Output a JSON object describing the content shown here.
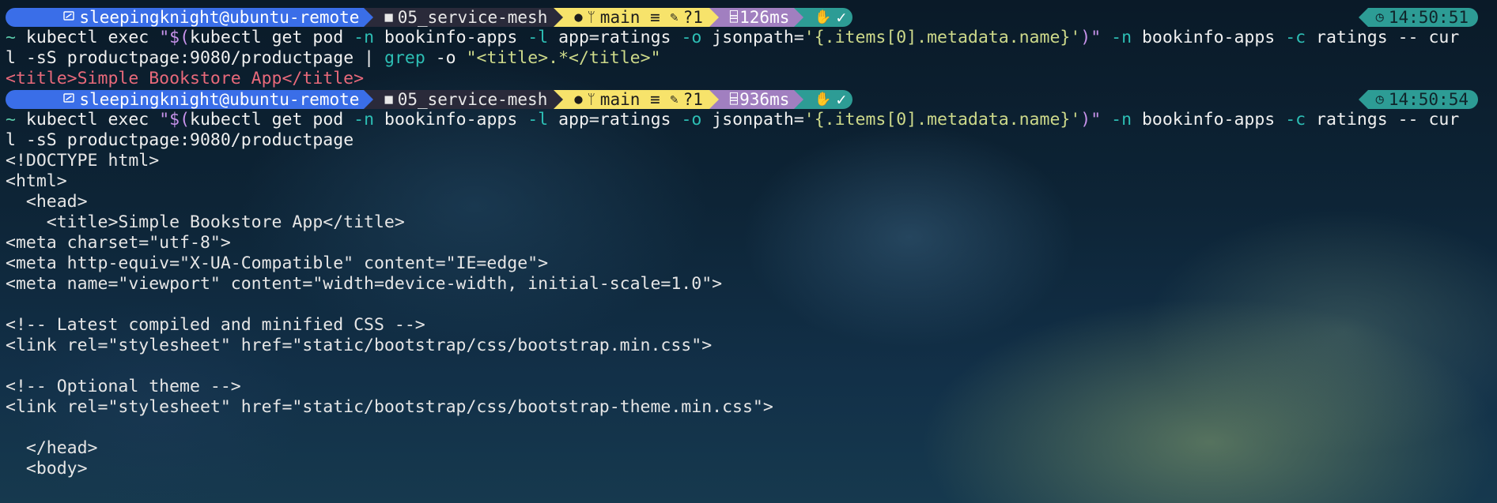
{
  "prompts": [
    {
      "user": "sleepingknight@ubuntu-remote",
      "dir": "05_service-mesh",
      "branch": "main",
      "git_flags": "≡",
      "git_changes": "?1",
      "exec_time": "126ms",
      "status": "✓",
      "clock": "14:50:51"
    },
    {
      "user": "sleepingknight@ubuntu-remote",
      "dir": "05_service-mesh",
      "branch": "main",
      "git_flags": "≡",
      "git_changes": "?1",
      "exec_time": "936ms",
      "status": "✓",
      "clock": "14:50:54"
    }
  ],
  "cmd1": {
    "tilde": "~",
    "kubectl": "kubectl",
    "exec": "exec",
    "sub_open": "\"$(",
    "inner_kubectl": "kubectl",
    "get_pod": "get pod",
    "n_flag": "-n",
    "ns": "bookinfo-apps",
    "l_flag": "-l",
    "label": "app=ratings",
    "o_flag": "-o",
    "jsonpath_key": "jsonpath=",
    "jsonpath_val": "'{.items[0].metadata.name}'",
    "sub_close": ")\"",
    "n_flag2": "-n",
    "ns2": "bookinfo-apps",
    "c_flag": "-c",
    "container": "ratings",
    "dashdash": "--",
    "cur": "cur",
    "line2_curl": "l",
    "sS": "-sS",
    "url": "productpage:9080/productpage",
    "pipe": "|",
    "grep": "grep",
    "grep_o": "-o",
    "grep_pattern": "\"<title>.*</title>\"",
    "output": "<title>Simple Bookstore App</title>"
  },
  "cmd2": {
    "tilde": "~",
    "kubectl": "kubectl",
    "exec": "exec",
    "sub_open": "\"$(",
    "inner_kubectl": "kubectl",
    "get_pod": "get pod",
    "n_flag": "-n",
    "ns": "bookinfo-apps",
    "l_flag": "-l",
    "label": "app=ratings",
    "o_flag": "-o",
    "jsonpath_key": "jsonpath=",
    "jsonpath_val": "'{.items[0].metadata.name}'",
    "sub_close": ")\"",
    "n_flag2": "-n",
    "ns2": "bookinfo-apps",
    "c_flag": "-c",
    "container": "ratings",
    "dashdash": "--",
    "cur": "cur",
    "line2_curl": "l",
    "sS": "-sS",
    "url": "productpage:9080/productpage"
  },
  "output_lines": [
    "<!DOCTYPE html>",
    "<html>",
    "  <head>",
    "    <title>Simple Bookstore App</title>",
    "<meta charset=\"utf-8\">",
    "<meta http-equiv=\"X-UA-Compatible\" content=\"IE=edge\">",
    "<meta name=\"viewport\" content=\"width=device-width, initial-scale=1.0\">",
    "",
    "<!-- Latest compiled and minified CSS -->",
    "<link rel=\"stylesheet\" href=\"static/bootstrap/css/bootstrap.min.css\">",
    "",
    "<!-- Optional theme -->",
    "<link rel=\"stylesheet\" href=\"static/bootstrap/css/bootstrap-theme.min.css\">",
    "",
    "  </head>",
    "  <body>"
  ],
  "colors": {
    "user_segment": "#3a6ee8",
    "dir_segment": "#2a2a3a",
    "git_segment": "#f7e36b",
    "exec_segment": "#a17fc0",
    "status_segment": "#2d9c95",
    "clock_segment": "#2d9c95",
    "string": "#cdd98a",
    "flag": "#2dbfb5",
    "error_red": "#e8697a"
  },
  "icons": {
    "user": "user-icon",
    "folder": "folder-icon",
    "github": "github-icon",
    "branch": "git-branch-icon",
    "edit": "edit-icon",
    "timer": "timer-icon",
    "hand": "hand-icon",
    "clock": "clock-icon"
  }
}
